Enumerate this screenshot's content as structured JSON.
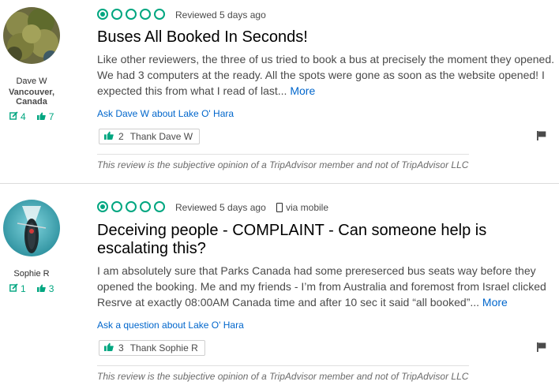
{
  "reviews": [
    {
      "member": {
        "name": "Dave W",
        "location": "Vancouver, Canada",
        "contributions": "4",
        "helpful_votes": "7"
      },
      "rating": 1,
      "date": "Reviewed 5 days ago",
      "title": "Buses All Booked In Seconds!",
      "text": "Like other reviewers, the three of us tried to book a bus at precisely the moment they opened. We had 3 computers at the ready. All the spots were gone as soon as the website opened! I expected this from what I read of last...",
      "more_label": "More",
      "ask_label": "Ask Dave W about Lake O' Hara",
      "thank_count": "2",
      "thank_label": "Thank Dave W",
      "disclaimer": "This review is the subjective opinion of a TripAdvisor member and not of TripAdvisor LLC"
    },
    {
      "member": {
        "name": "Sophie R",
        "location": "",
        "contributions": "1",
        "helpful_votes": "3"
      },
      "rating": 1,
      "date": "Reviewed 5 days ago",
      "via_mobile": "via mobile",
      "title": "Deceiving people - COMPLAINT - Can someone help is escalating this?",
      "text": "I am absolutely sure that Parks Canada had some prereserced bus seats way before they opened the booking. Me and my friends - I’m from Australia and foremost from Israel clicked Resrve at exactly 08:00AM Canada time and after 10 sec it said “all booked”...",
      "more_label": "More",
      "ask_label": "Ask a question about Lake O' Hara",
      "thank_count": "3",
      "thank_label": "Thank Sophie R",
      "disclaimer": "This review is the subjective opinion of a TripAdvisor member and not of TripAdvisor LLC"
    }
  ],
  "colors": {
    "accent_green": "#00a680",
    "link_blue": "#0066cc"
  },
  "icons": [
    "contribution-icon",
    "thumbs-up-icon",
    "flag-icon",
    "mobile-phone-icon",
    "rating-bubble-icon"
  ]
}
